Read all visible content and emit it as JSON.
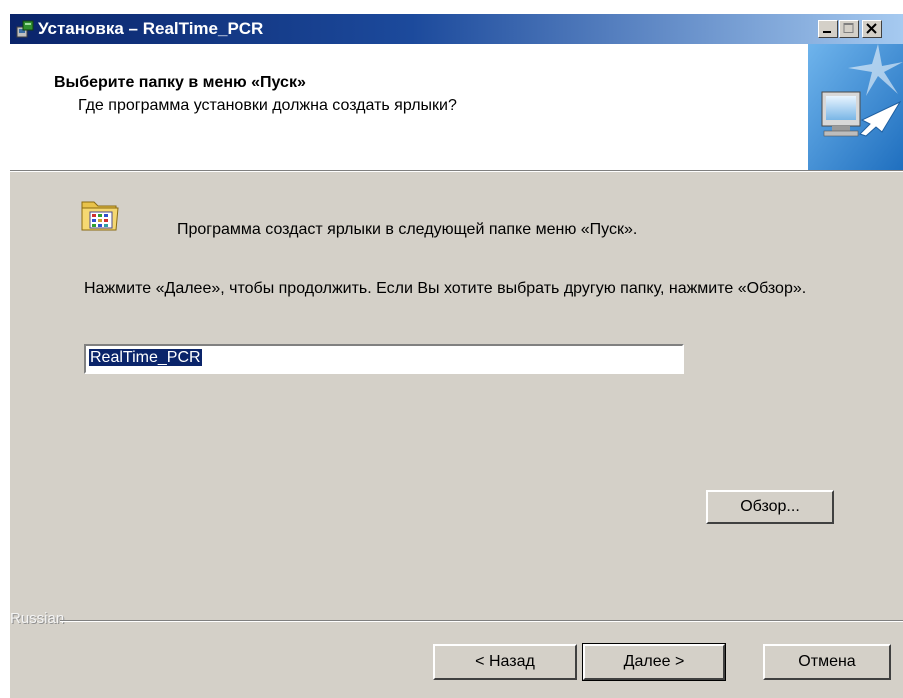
{
  "window": {
    "title": "Установка – RealTime_PCR",
    "icon": "installer-icon",
    "controls": [
      "minimize-icon",
      "maximize-icon",
      "close-icon"
    ]
  },
  "header": {
    "title": "Выберите папку в меню «Пуск»",
    "subtitle": "Где программа установки должна создать ярлыки?",
    "graphic": "computer-arrow-icon"
  },
  "content": {
    "folder_icon": "start-menu-folder-icon",
    "info_text": "Программа создаст ярлыки в следующей папке меню «Пуск».",
    "instruction": "Нажмите «Далее», чтобы продолжить. Если Вы хотите выбрать другую папку, нажмите «Обзор».",
    "folder_input_value": "RealTime_PCR",
    "browse_label": "Обзор..."
  },
  "footer": {
    "language": "Russian",
    "back_label": "< Назад",
    "next_label": "Далее >",
    "cancel_label": "Отмена"
  },
  "colors": {
    "titlebar_start": "#0a246a",
    "titlebar_end": "#a6caf0",
    "face": "#d4d0c8",
    "selection": "#0a246a"
  }
}
